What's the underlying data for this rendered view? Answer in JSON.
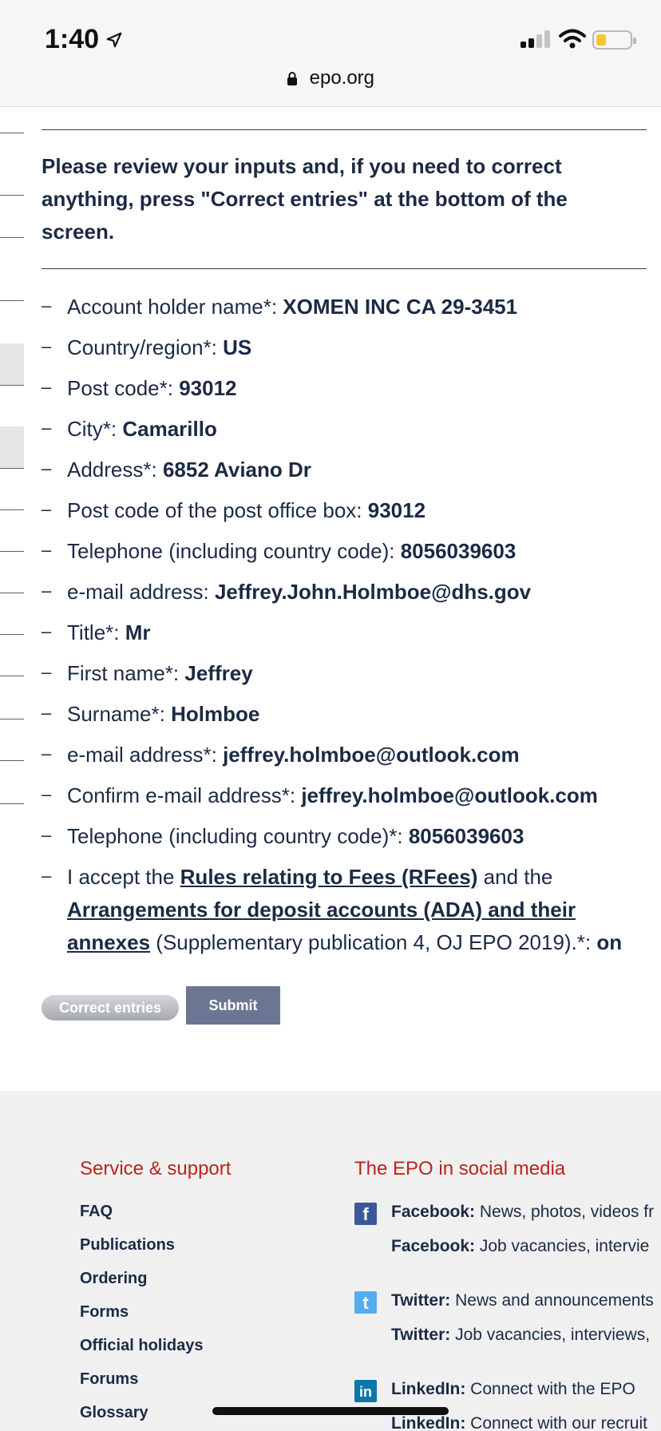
{
  "status_bar": {
    "time": "1:40",
    "url": "epo.org"
  },
  "notice": "Please review your inputs and, if you need to correct anything, press \"Correct entries\" at the bottom of the screen.",
  "entries": [
    {
      "label": "Account holder name*: ",
      "value": "XOMEN INC CA 29-3451"
    },
    {
      "label": "Country/region*: ",
      "value": "US"
    },
    {
      "label": "Post code*: ",
      "value": "93012"
    },
    {
      "label": "City*: ",
      "value": "Camarillo"
    },
    {
      "label": "Address*: ",
      "value": "6852 Aviano Dr"
    },
    {
      "label": "Post code of the post office box: ",
      "value": "93012"
    },
    {
      "label": "Telephone (including country code): ",
      "value": "8056039603"
    },
    {
      "label": "e-mail address: ",
      "value": "Jeffrey.John.Holmboe@dhs.gov"
    },
    {
      "label": "Title*: ",
      "value": "Mr"
    },
    {
      "label": "First name*: ",
      "value": "Jeffrey"
    },
    {
      "label": "Surname*: ",
      "value": "Holmboe"
    },
    {
      "label": "e-mail address*: ",
      "value": "jeffrey.holmboe@outlook.com"
    },
    {
      "label": "Confirm e-mail address*: ",
      "value": "jeffrey.holmboe@outlook.com"
    },
    {
      "label": "Telephone (including country code)*: ",
      "value": "8056039603"
    }
  ],
  "accept": {
    "prefix": "I accept the ",
    "link1": "Rules relating to Fees (RFees)",
    "middle": " and the ",
    "link2": "Arrangements for deposit accounts (ADA) and their annexes",
    "suffix": " (Supplementary publication 4, OJ EPO 2019).*: ",
    "value": "on"
  },
  "buttons": {
    "correct": "Correct entries",
    "submit": "Submit"
  },
  "footer": {
    "service_title": "Service & support",
    "service_links": [
      "FAQ",
      "Publications",
      "Ordering",
      "Forms",
      "Official holidays",
      "Forums",
      "Glossary"
    ],
    "social_title": "The EPO in social media",
    "social": [
      {
        "name": "Facebook:",
        "text": " News, photos, videos fr"
      },
      {
        "name": "Facebook:",
        "text": " Job vacancies, intervie"
      },
      {
        "name": "Twitter:",
        "text": " News and announcements"
      },
      {
        "name": "Twitter:",
        "text": " Job vacancies, interviews,"
      },
      {
        "name": "LinkedIn:",
        "text": " Connect with the EPO"
      },
      {
        "name": "LinkedIn:",
        "text": " Connect with our recruit"
      }
    ]
  }
}
